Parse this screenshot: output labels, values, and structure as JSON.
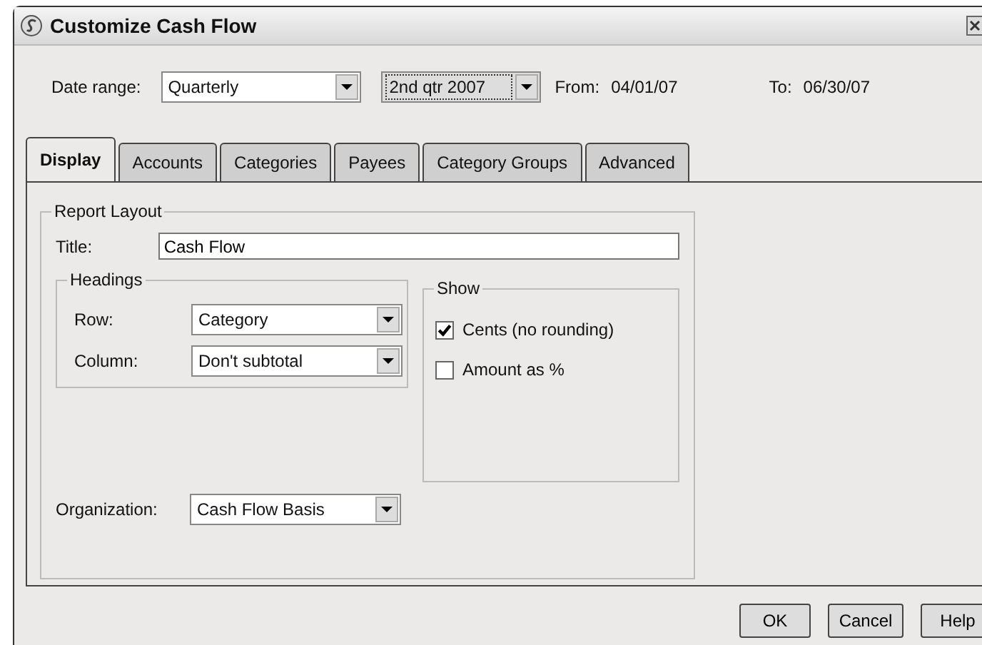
{
  "window": {
    "title": "Customize Cash Flow"
  },
  "date_range": {
    "label": "Date range:",
    "period": "Quarterly",
    "quarter": "2nd qtr 2007",
    "from_label": "From:",
    "from": "04/01/07",
    "to_label": "To:",
    "to": "06/30/07"
  },
  "tabs": [
    {
      "label": "Display",
      "selected": true
    },
    {
      "label": "Accounts",
      "selected": false
    },
    {
      "label": "Categories",
      "selected": false
    },
    {
      "label": "Payees",
      "selected": false
    },
    {
      "label": "Category Groups",
      "selected": false
    },
    {
      "label": "Advanced",
      "selected": false
    }
  ],
  "report_layout": {
    "legend": "Report Layout",
    "title_label": "Title:",
    "title_value": "Cash Flow",
    "headings": {
      "legend": "Headings",
      "rows": [
        {
          "label": "Row:",
          "value": "Category"
        },
        {
          "label": "Column:",
          "value": "Don't subtotal"
        }
      ]
    },
    "show": {
      "legend": "Show",
      "options": [
        {
          "label": "Cents (no rounding)",
          "checked": true
        },
        {
          "label": "Amount as %",
          "checked": false
        }
      ]
    },
    "organization": {
      "label": "Organization:",
      "value": "Cash Flow Basis"
    }
  },
  "buttons": [
    "OK",
    "Cancel",
    "Help"
  ]
}
